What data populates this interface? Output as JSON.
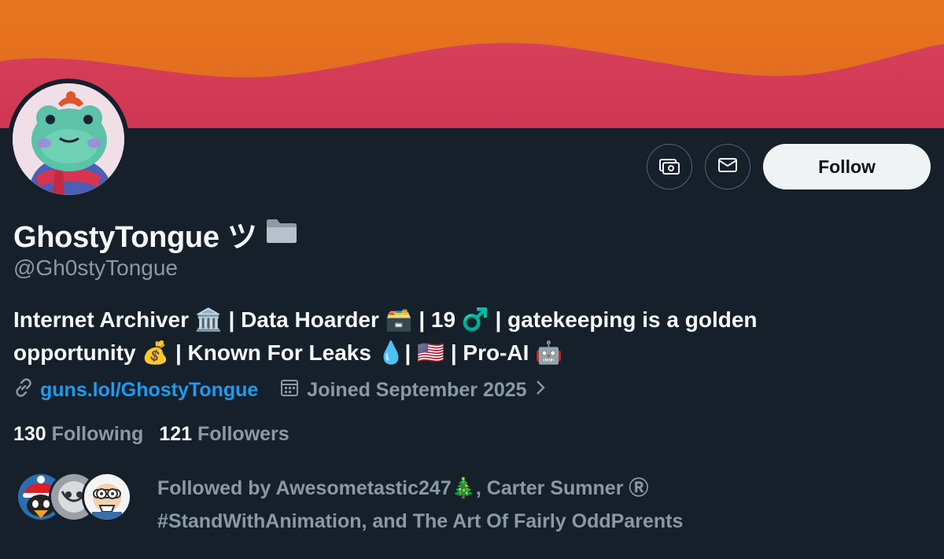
{
  "profile": {
    "display_name": "GhostyTongue ツ",
    "name_badge_icon": "folder-icon",
    "handle": "@Gh0styTongue",
    "bio_line1": "Internet Archiver 🏛️ | Data Hoarder 🗃️ | 19 ♂️ | gatekeeping is a golden",
    "bio_line2": "opportunity 💰 | Known For Leaks 💧| 🇺🇸 | Pro-AI 🤖",
    "website": "guns.lol/GhostyTongue",
    "joined": "Joined September 2025",
    "following_count": "130",
    "following_label": "Following",
    "followers_count": "121",
    "followers_label": "Followers"
  },
  "actions": {
    "tip_icon": "money-icon",
    "message_icon": "envelope-icon",
    "follow_label": "Follow"
  },
  "followed_by": {
    "line1": "Followed by Awesometastic247🎄, Carter Sumner Ⓡ",
    "line2": "#StandWithAnimation, and The Art Of Fairly OddParents"
  },
  "colors": {
    "background": "#15202b",
    "banner_top": "#e3731f",
    "banner_bottom": "#d43a55",
    "link": "#1d9bf0",
    "muted": "#8b98a5",
    "follow_bg": "#eff3f4"
  }
}
